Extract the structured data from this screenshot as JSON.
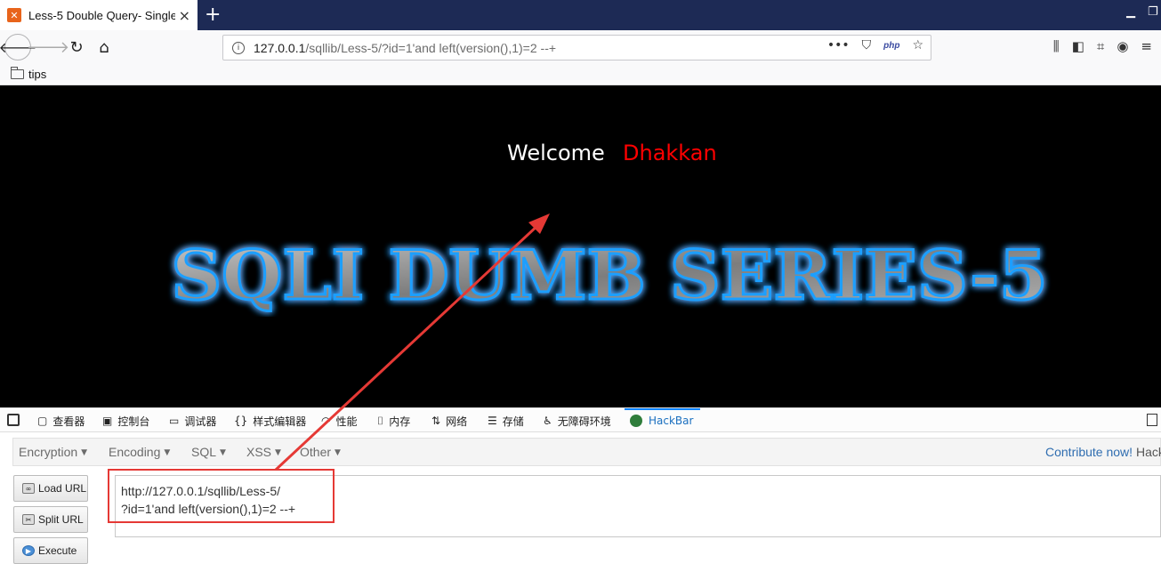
{
  "browser": {
    "tab_title": "Less-5 Double Query- Single",
    "tab_favicon": "xampp-icon",
    "new_tab_symbol": "+",
    "url_host": "127.0.0.1",
    "url_path": "/sqllib/Less-5/?id=1'and left(version(),1)=2 --+",
    "bookmark_folder": "tips",
    "php_badge": "php"
  },
  "page": {
    "welcome_label": "Welcome",
    "welcome_name": "Dhakkan",
    "banner_text": "SQLI DUMB SERIES-5",
    "colors": {
      "name": "#ff0000",
      "background": "#000000",
      "banner_glow": "#1e9fff"
    }
  },
  "devtools": {
    "tabs": [
      {
        "label": "查看器",
        "icon": "inspector-icon"
      },
      {
        "label": "控制台",
        "icon": "console-icon"
      },
      {
        "label": "调试器",
        "icon": "debugger-icon"
      },
      {
        "label": "样式编辑器",
        "icon": "style-editor-icon"
      },
      {
        "label": "性能",
        "icon": "performance-icon"
      },
      {
        "label": "内存",
        "icon": "memory-icon"
      },
      {
        "label": "网络",
        "icon": "network-icon"
      },
      {
        "label": "存储",
        "icon": "storage-icon"
      },
      {
        "label": "无障碍环境",
        "icon": "accessibility-icon"
      },
      {
        "label": "HackBar",
        "icon": "hackbar-icon"
      }
    ],
    "active_tab": "HackBar"
  },
  "hackbar": {
    "menus": [
      "Encryption",
      "Encoding",
      "SQL",
      "XSS",
      "Other"
    ],
    "contribute_label": "Contribute now!",
    "contribute_tail": "Hack",
    "buttons": {
      "load": "Load URL",
      "split": "Split URL",
      "execute": "Execute"
    },
    "url_line1": "http://127.0.0.1/sqllib/Less-5/",
    "url_line2": "?id=1'and left(version(),1)=2 --+"
  }
}
